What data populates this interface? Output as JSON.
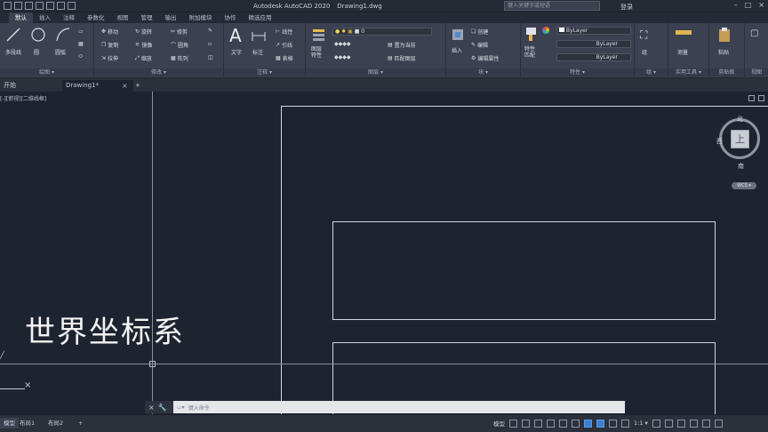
{
  "app": {
    "title": "Autodesk AutoCAD 2020",
    "document": "Drawing1.dwg",
    "search_placeholder": "键入关键字或短语",
    "login": "登录"
  },
  "menu_tabs": [
    "默认",
    "插入",
    "注释",
    "参数化",
    "视图",
    "管理",
    "输出",
    "附加模块",
    "协作",
    "精选应用"
  ],
  "ribbon": {
    "draw": {
      "title": "绘图 ▾",
      "line": "直线",
      "polyline": "多段线",
      "circle": "圆",
      "arc": "圆弧"
    },
    "modify": {
      "title": "修改 ▾",
      "move": "移动",
      "rotate": "旋转",
      "trim": "修剪",
      "copy": "复制",
      "mirror": "镜像",
      "fillet": "圆角",
      "stretch": "拉伸",
      "scale": "缩放",
      "array": "阵列"
    },
    "annotation": {
      "title": "注释 ▾",
      "text": "文字",
      "dimension": "标注",
      "linear": "线性",
      "leader": "引线",
      "table": "表格"
    },
    "layers": {
      "title": "图层 ▾",
      "layer_properties": "图层\n特性",
      "current_layer": "0",
      "make_current": "置为当前",
      "match_layer": "匹配图层"
    },
    "block": {
      "title": "块 ▾",
      "insert": "插入",
      "create": "创建",
      "edit": "编辑",
      "edit_attributes": "编辑属性"
    },
    "properties": {
      "title": "特性 ▾",
      "match_properties": "特性\n匹配",
      "color": "ByLayer",
      "linetype": "ByLayer",
      "lineweight": "ByLayer"
    },
    "groups": {
      "title": "组 ▾",
      "group": "组"
    },
    "utilities": {
      "title": "实用工具 ▾",
      "measure": "测量"
    },
    "clipboard": {
      "title": "剪贴板",
      "paste": "粘贴"
    },
    "view": {
      "title": "视图"
    }
  },
  "doc_tabs": {
    "start": "开始",
    "drawing": "Drawing1*",
    "add": "+"
  },
  "viewport_label": "[-][俯视][二维线框]",
  "caption": "世界坐标系",
  "viewcube": {
    "top_face": "上",
    "north": "北",
    "south": "南",
    "west": "西",
    "wcs": "WCS ▾"
  },
  "command_line": {
    "placeholder": "键入命令"
  },
  "layout_tabs": [
    "模型",
    "布局1",
    "布局2",
    "+"
  ],
  "status": {
    "model": "模型",
    "scale": "1:1 ▾"
  },
  "colors": {
    "canvas": "#1e2330",
    "ribbon": "#3b4150",
    "accent": "#3d7fd1"
  }
}
